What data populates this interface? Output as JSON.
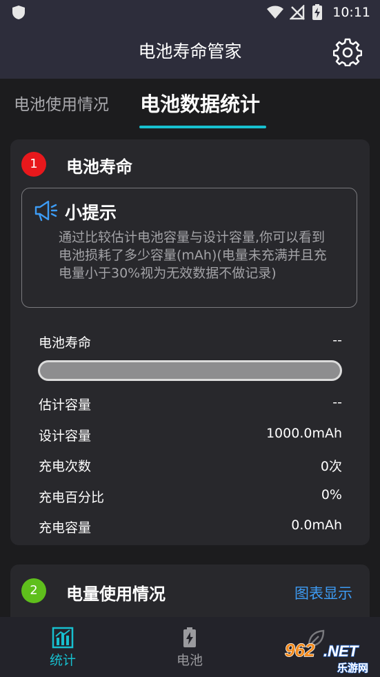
{
  "status_bar": {
    "time": "10:11"
  },
  "app_bar": {
    "title": "电池寿命管家"
  },
  "tabs": [
    {
      "label": "电池使用情况",
      "active": false
    },
    {
      "label": "电池数据统计",
      "active": true
    }
  ],
  "colors": {
    "accent": "#17c0cf",
    "badge1": "#e8181c",
    "badge2": "#5fbf1c",
    "link": "#3d9cf5"
  },
  "section1": {
    "number": "1",
    "title": "电池寿命",
    "tip": {
      "icon": "megaphone-icon",
      "title": "小提示",
      "text": "通过比较估计电池容量与设计容量,你可以看到电池损耗了多少容量(mAh)(电量未充满并且充电量小于30%视为无效数据不做记录)"
    },
    "life": {
      "label": "电池寿命",
      "value": "--",
      "progress_fraction": 0
    },
    "stats": [
      {
        "label": "估计容量",
        "value": "--"
      },
      {
        "label": "设计容量",
        "value": "1000.0mAh"
      },
      {
        "label": "充电次数",
        "value": "0次"
      },
      {
        "label": "充电百分比",
        "value": "0%"
      },
      {
        "label": "充电容量",
        "value": "0.0mAh"
      }
    ]
  },
  "section2": {
    "number": "2",
    "title": "电量使用情况",
    "link": "图表显示"
  },
  "bottom_nav": [
    {
      "label": "统计",
      "icon": "bar-chart-icon",
      "active": true
    },
    {
      "label": "电池",
      "icon": "battery-icon",
      "active": false
    }
  ],
  "watermark": {
    "line1": "962.NET",
    "line2": "乐游网"
  }
}
